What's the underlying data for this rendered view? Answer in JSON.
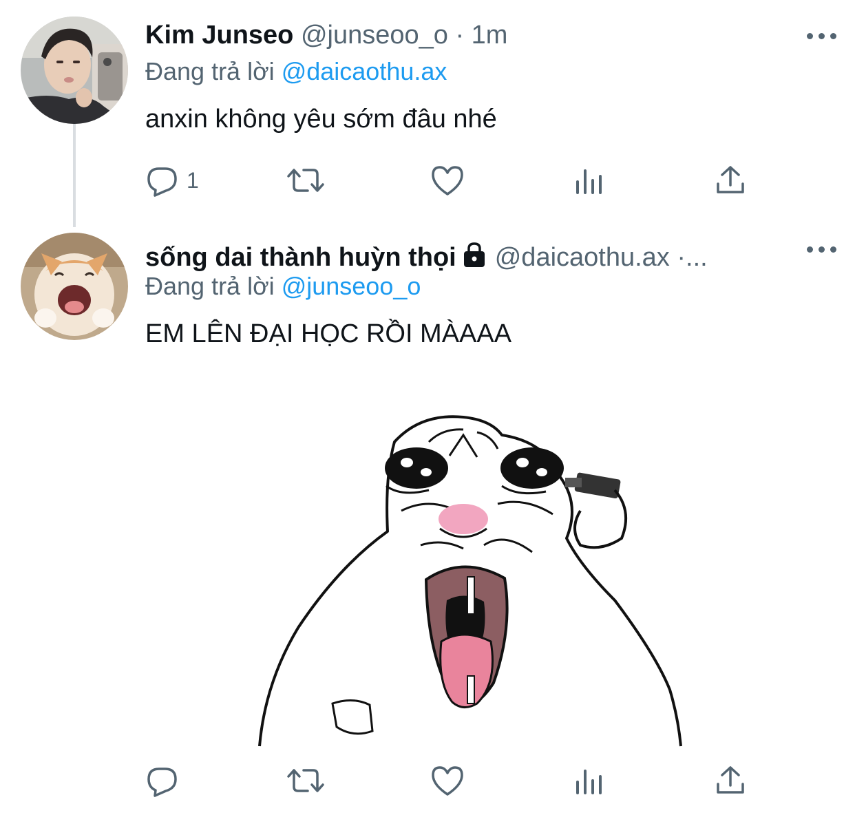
{
  "tweets": [
    {
      "author_name": "Kim Junseo",
      "author_handle": "@junseoo_o · 1m",
      "reply_prefix": "Đang trả lời",
      "reply_mention": "@daicaothu.ax",
      "text": "anxin không yêu sớm đâu nhé",
      "reply_count": "1",
      "avatar_icon": "person-photo-avatar"
    },
    {
      "author_name": "sống dai thành huỳn thọi",
      "author_handle": "@daicaothu.ax ·...",
      "reply_prefix": "Đang trả lời",
      "reply_mention": "@junseoo_o",
      "text": "EM LÊN ĐẠI HỌC RỒI MÀAAA",
      "reply_count": "",
      "avatar_icon": "laughing-cat-avatar",
      "protected": true,
      "media_icon": "crying-meme-cartoon-image"
    }
  ],
  "actions": [
    "reply-icon",
    "retweet-icon",
    "like-icon",
    "analytics-icon",
    "share-icon"
  ],
  "colors": {
    "text": "#0f1419",
    "secondary": "#536471",
    "link": "#1d9bf0",
    "thread_line": "#d9dde1"
  }
}
